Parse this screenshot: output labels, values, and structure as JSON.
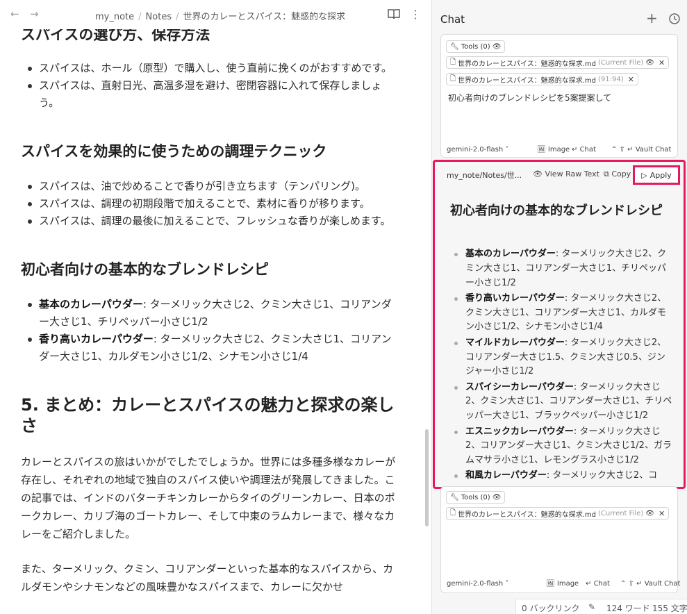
{
  "note": {
    "breadcrumb": [
      "my_note",
      "Notes",
      "世界のカレーとスパイス：魅惑的な探求"
    ],
    "section1": {
      "heading": "スパイスの選び方、保存方法",
      "bullets": [
        "スパイスは、ホール（原型）で購入し、使う直前に挽くのがおすすめです。",
        "スパイスは、直射日光、高温多湿を避け、密閉容器に入れて保存しましょう。"
      ]
    },
    "section2": {
      "heading": "スパイスを効果的に使うための調理テクニック",
      "bullets": [
        "スパイスは、油で炒めることで香りが引き立ちます（テンパリング)。",
        "スパイスは、調理の初期段階で加えることで、素材に香りが移ります。",
        "スパイスは、調理の最後に加えることで、フレッシュな香りが楽しめます。"
      ]
    },
    "section3": {
      "heading": "初心者向けの基本的なブレンドレシピ",
      "items": [
        {
          "name": "基本のカレーパウダー",
          "desc": ": ターメリック大さじ2、クミン大さじ1、コリアンダー大さじ1、チリペッパー小さじ1/2"
        },
        {
          "name": "香り高いカレーパウダー",
          "desc": ": ターメリック大さじ2、クミン大さじ1、コリアンダー大さじ1、カルダモン小さじ1/2、シナモン小さじ1/4"
        }
      ]
    },
    "section4": {
      "heading": "5. まとめ：カレーとスパイスの魅力と探求の楽しさ",
      "para1": "カレーとスパイスの旅はいかがでしたでしょうか。世界には多種多様なカレーが存在し、それぞれの地域で独自のスパイス使いや調理法が発展してきました。この記事では、インドのバターチキンカレーからタイのグリーンカレー、日本のポークカレー、カリブ海のゴートカレー、そして中東のラムカレーまで、様々なカレーをご紹介しました。",
      "para2": "また、ターメリック、クミン、コリアンダーといった基本的なスパイスから、カルダモンやシナモンなどの風味豊かなスパイスまで、カレーに欠かせ"
    }
  },
  "chat": {
    "title": "Chat",
    "input1": {
      "tools": "Tools (0)",
      "file1": "世界のカレーとスパイス：魅惑的な探求.md",
      "file1_tag": "(Current File)",
      "file2": "世界のカレーとスパイス：魅惑的な探求.md",
      "file2_tag": "(91:94)",
      "prompt": "初心者向けのブレンドレシピを5案提案して",
      "model": "gemini-2.0-flash",
      "image_label": "Image",
      "chat_label": "Chat",
      "vault_label": "Vault Chat"
    },
    "response": {
      "path": "my_note/Notes/世...",
      "view_raw": "View Raw Text",
      "copy": "Copy",
      "apply": "Apply",
      "heading": "初心者向けの基本的なブレンドレシピ",
      "items": [
        {
          "name": "基本のカレーパウダー",
          "desc": ": ターメリック大さじ2、クミン大さじ1、コリアンダー大さじ1、チリペッパー小さじ1/2"
        },
        {
          "name": "香り高いカレーパウダー",
          "desc": ": ターメリック大さじ2、クミン大さじ1、コリアンダー大さじ1、カルダモン小さじ1/2、シナモン小さじ1/4"
        },
        {
          "name": "マイルドカレーパウダー",
          "desc": ": ターメリック大さじ2、コリアンダー大さじ1.5、クミン大さじ0.5、ジンジャー小さじ1/2"
        },
        {
          "name": "スパイシーカレーパウダー",
          "desc": ": ターメリック大さじ2、クミン大さじ1、コリアンダー大さじ1、チリペッパー大さじ1、ブラックペッパー小さじ1/2"
        },
        {
          "name": "エスニックカレーパウダー",
          "desc": ": ターメリック大さじ2、コリアンダー大さじ1、クミン大さじ1/2、ガラムマサラ小さじ1、レモングラス小さじ1/2"
        },
        {
          "name": "和風カレーパウダー",
          "desc": ": ターメリック大さじ2、コ"
        }
      ]
    },
    "input2": {
      "tools": "Tools (0)",
      "file1": "世界のカレーとスパイス：魅惑的な探求.md",
      "file1_tag": "(Current File)",
      "model": "gemini-2.0-flash",
      "image_label": "Image",
      "chat_label": "Chat",
      "vault_label": "Vault Chat"
    }
  },
  "status": {
    "backlinks": "0 バックリンク",
    "words": "124 ワード",
    "chars": "155 文字"
  },
  "colors": {
    "highlight": "#e8185c"
  }
}
